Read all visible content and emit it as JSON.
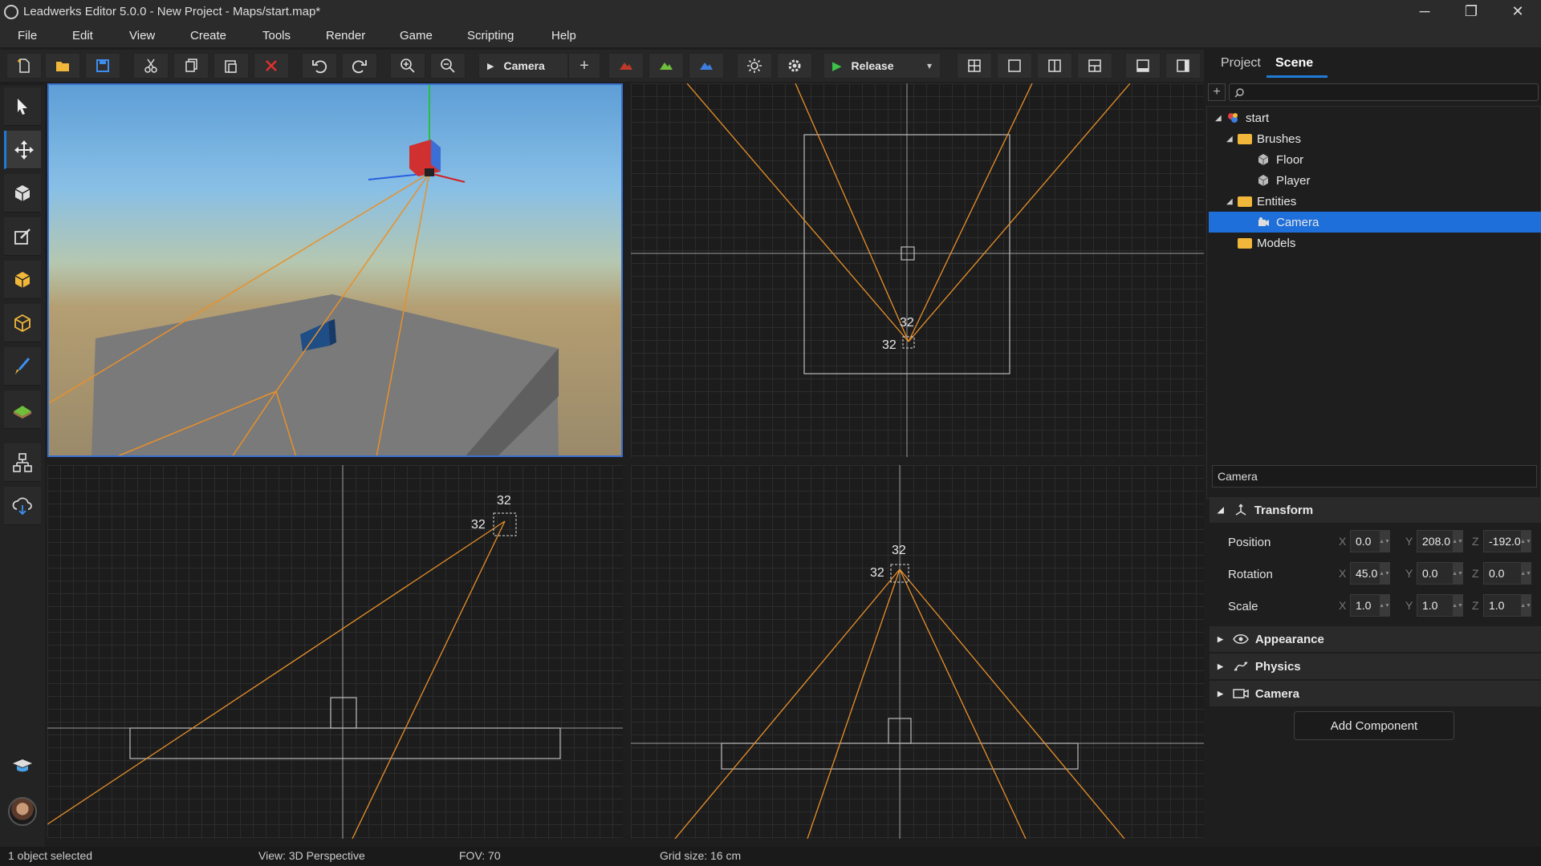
{
  "window": {
    "title": "Leadwerks Editor 5.0.0 - New Project - Maps/start.map*",
    "minimize": "─",
    "maximize": "❐",
    "close": "✕"
  },
  "menu": [
    "File",
    "Edit",
    "View",
    "Create",
    "Tools",
    "Render",
    "Game",
    "Scripting",
    "Help"
  ],
  "toolbar": {
    "camera_label": "Camera",
    "add": "+",
    "run_label": "Release",
    "run_arrow": "▾"
  },
  "panel": {
    "tabs": [
      "Project",
      "Scene"
    ],
    "active_tab": "Scene",
    "search_placeholder": "",
    "tree": [
      {
        "label": "start",
        "depth": 0,
        "icon": "scene-icon",
        "arrow": "◢"
      },
      {
        "label": "Brushes",
        "depth": 1,
        "icon": "folder-icon",
        "arrow": "◢"
      },
      {
        "label": "Floor",
        "depth": 2,
        "icon": "cube-icon",
        "arrow": ""
      },
      {
        "label": "Player",
        "depth": 2,
        "icon": "cube-icon",
        "arrow": ""
      },
      {
        "label": "Entities",
        "depth": 1,
        "icon": "folder-icon",
        "arrow": "◢"
      },
      {
        "label": "Camera",
        "depth": 2,
        "icon": "camera-icon",
        "arrow": "",
        "selected": true
      },
      {
        "label": "Models",
        "depth": 1,
        "icon": "folder-icon",
        "arrow": ""
      }
    ]
  },
  "properties": {
    "name_field": "Camera",
    "transform_title": "Transform",
    "position_label": "Position",
    "rotation_label": "Rotation",
    "scale_label": "Scale",
    "position": {
      "x": "0.0",
      "y": "208.0",
      "z": "-192.0"
    },
    "rotation": {
      "x": "45.0",
      "y": "0.0",
      "z": "0.0"
    },
    "scale": {
      "x": "1.0",
      "y": "1.0",
      "z": "1.0"
    },
    "axis_x": "X",
    "axis_y": "Y",
    "axis_z": "Z",
    "appearance": "Appearance",
    "physics": "Physics",
    "camera": "Camera",
    "add_component": "Add Component"
  },
  "viewports": {
    "size_label": "32"
  },
  "status": {
    "selection": "1 object selected",
    "view": "View: 3D Perspective",
    "fov": "FOV: 70",
    "grid": "Grid size: 16 cm"
  },
  "colors": {
    "accent": "#1e6fd9",
    "frustum": "#e39a35",
    "folder": "#f0b73a"
  }
}
